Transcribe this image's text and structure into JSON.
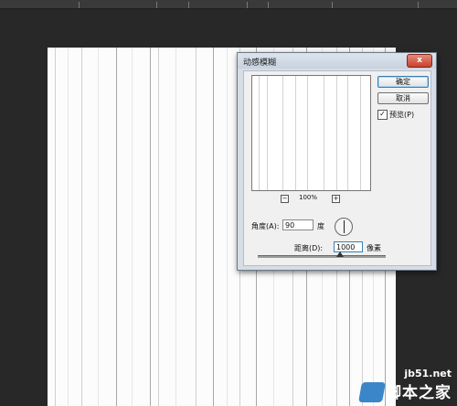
{
  "dialog": {
    "title": "动感模糊",
    "close_label": "x",
    "ok_label": "确定",
    "cancel_label": "取消",
    "preview_checked_mark": "✓",
    "preview_label": "预览(P)",
    "zoom_out_label": "−",
    "zoom_in_label": "+",
    "zoom_level": "100%",
    "angle_label": "角度(A):",
    "angle_value": "90",
    "angle_unit": "度",
    "distance_label": "距离(D):",
    "distance_value": "1000",
    "distance_unit": "像素"
  },
  "watermark": {
    "site": "jb51.net",
    "name": "脚本之家"
  }
}
